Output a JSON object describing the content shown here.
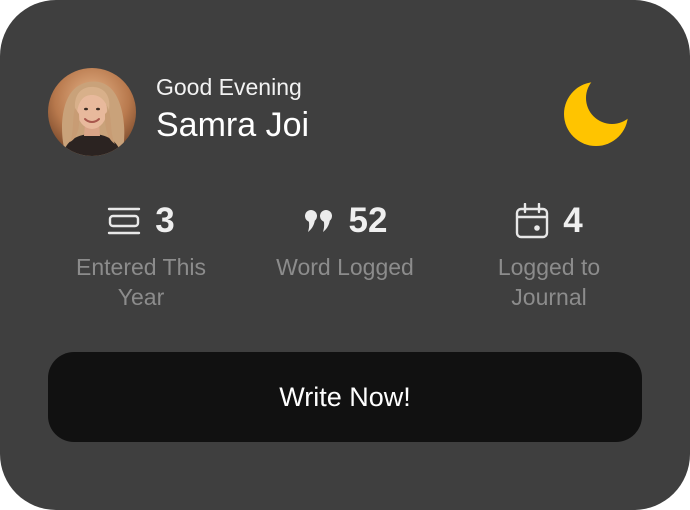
{
  "profile": {
    "greeting": "Good Evening",
    "name": "Samra Joi",
    "avatar_icon": "avatar-photo",
    "mode_icon": "moon-icon",
    "moon_color": "#FFC400"
  },
  "stats": [
    {
      "icon": "stack-icon",
      "value": "3",
      "label": "Entered This Year"
    },
    {
      "icon": "quote-icon",
      "value": "52",
      "label": "Word Logged"
    },
    {
      "icon": "calendar-icon",
      "value": "4",
      "label": "Logged to Journal"
    }
  ],
  "cta": {
    "label": "Write Now!"
  },
  "colors": {
    "card_bg": "#3F3F3F",
    "button_bg": "#111111",
    "label_gray": "#8C8C8C"
  }
}
